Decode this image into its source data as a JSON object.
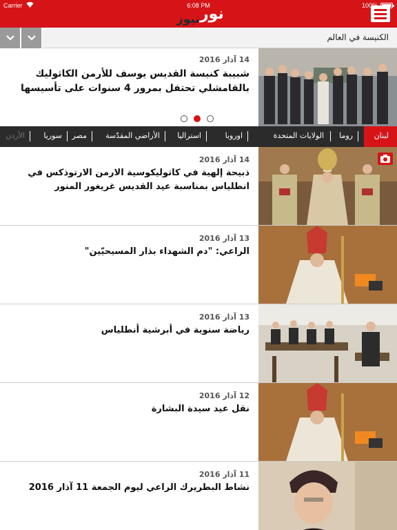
{
  "status": {
    "carrier": "Carrier",
    "time": "6:08 PM",
    "battery": "100%",
    "battery_level": 1.0
  },
  "header": {
    "logo_noor": "نور",
    "logo_news": "نيوز",
    "menu_icon": "hamburger-icon",
    "brand_color": "#d61418"
  },
  "section": {
    "title": "الكنيسة في العالم",
    "nav_icons": [
      "chevron-down-icon",
      "chevron-down-icon"
    ]
  },
  "featured": {
    "date": "14 آذار 2016",
    "title": "شبيبة كنيسة القديس يوسف للأرمن الكاثوليك بالقامشلي تحتفل بمرور 4 سنوات على تأسيسها",
    "pager_count": 3,
    "pager_active": 2
  },
  "categories": {
    "items": [
      "لبنان",
      "روما",
      "الولايات المتحدة",
      "اوروبا",
      "استراليا",
      "الأراضي المقدّسة",
      "مصر",
      "سوريا",
      "الأردن"
    ],
    "active_index": 0
  },
  "articles": [
    {
      "date": "14 آذار 2016",
      "title": "ذبيحة إلهية في كاتوليكوسية الارمن الارتوذكس في انطلياس بمناسبة عيد القديس غريغور المنور",
      "has_camera": true
    },
    {
      "date": "13 آذار 2016",
      "title": "الراعي: \"دم الشهداء بذار المسيحيّين\"",
      "has_camera": false
    },
    {
      "date": "13 آذار 2016",
      "title": "رياضة سنوية في أبرشية أنطلياس",
      "has_camera": false
    },
    {
      "date": "12 آذار 2016",
      "title": "نقل عيد سيدة البشارة",
      "has_camera": false
    },
    {
      "date": "11 آذار 2016",
      "title": "نشاط البطريرك الراعي ليوم الجمعة 11 آذار 2016",
      "has_camera": false
    }
  ]
}
